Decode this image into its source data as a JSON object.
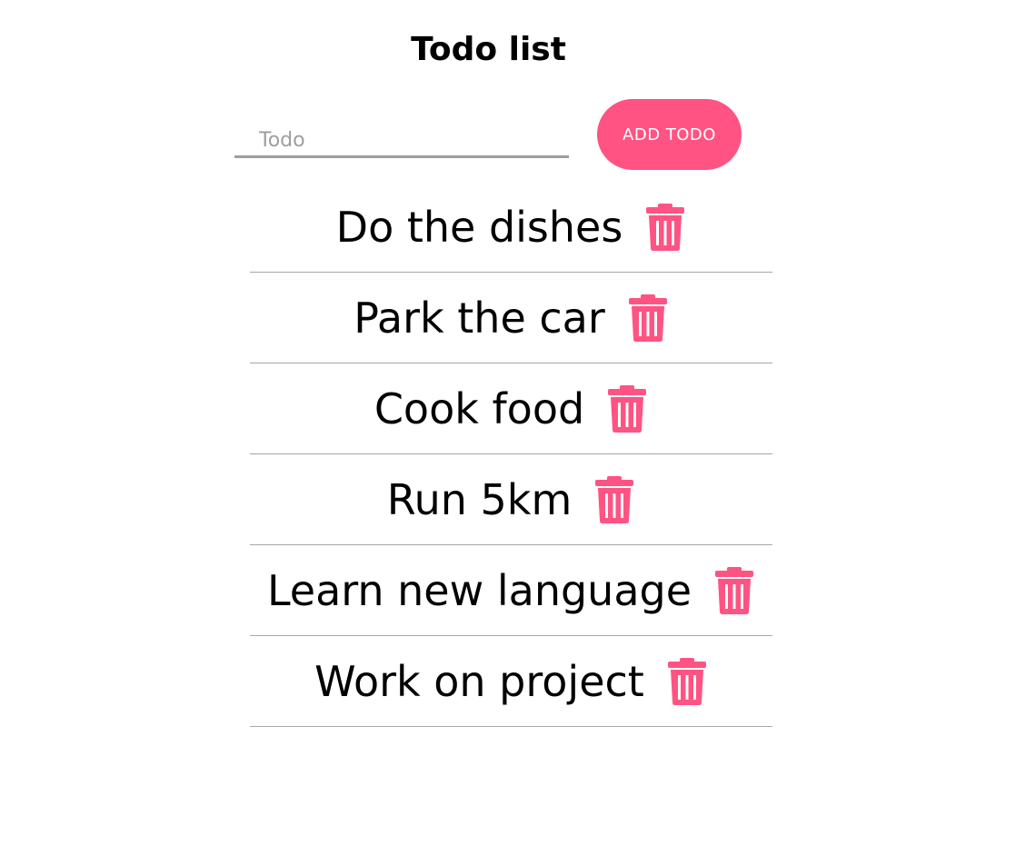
{
  "header": {
    "title": "Todo list"
  },
  "form": {
    "input_placeholder": "Todo",
    "input_value": "",
    "add_button_label": "ADD TODO"
  },
  "todos": [
    {
      "text": "Do the dishes",
      "delete_icon": "trash-icon"
    },
    {
      "text": "Park the car",
      "delete_icon": "trash-icon"
    },
    {
      "text": "Cook food",
      "delete_icon": "trash-icon"
    },
    {
      "text": "Run 5km",
      "delete_icon": "trash-icon"
    },
    {
      "text": "Learn new language",
      "delete_icon": "trash-icon"
    },
    {
      "text": "Work on project",
      "delete_icon": "trash-icon"
    }
  ],
  "colors": {
    "accent": "#ff5383",
    "underline": "#9e9e9e",
    "divider": "#a6a6a6"
  }
}
